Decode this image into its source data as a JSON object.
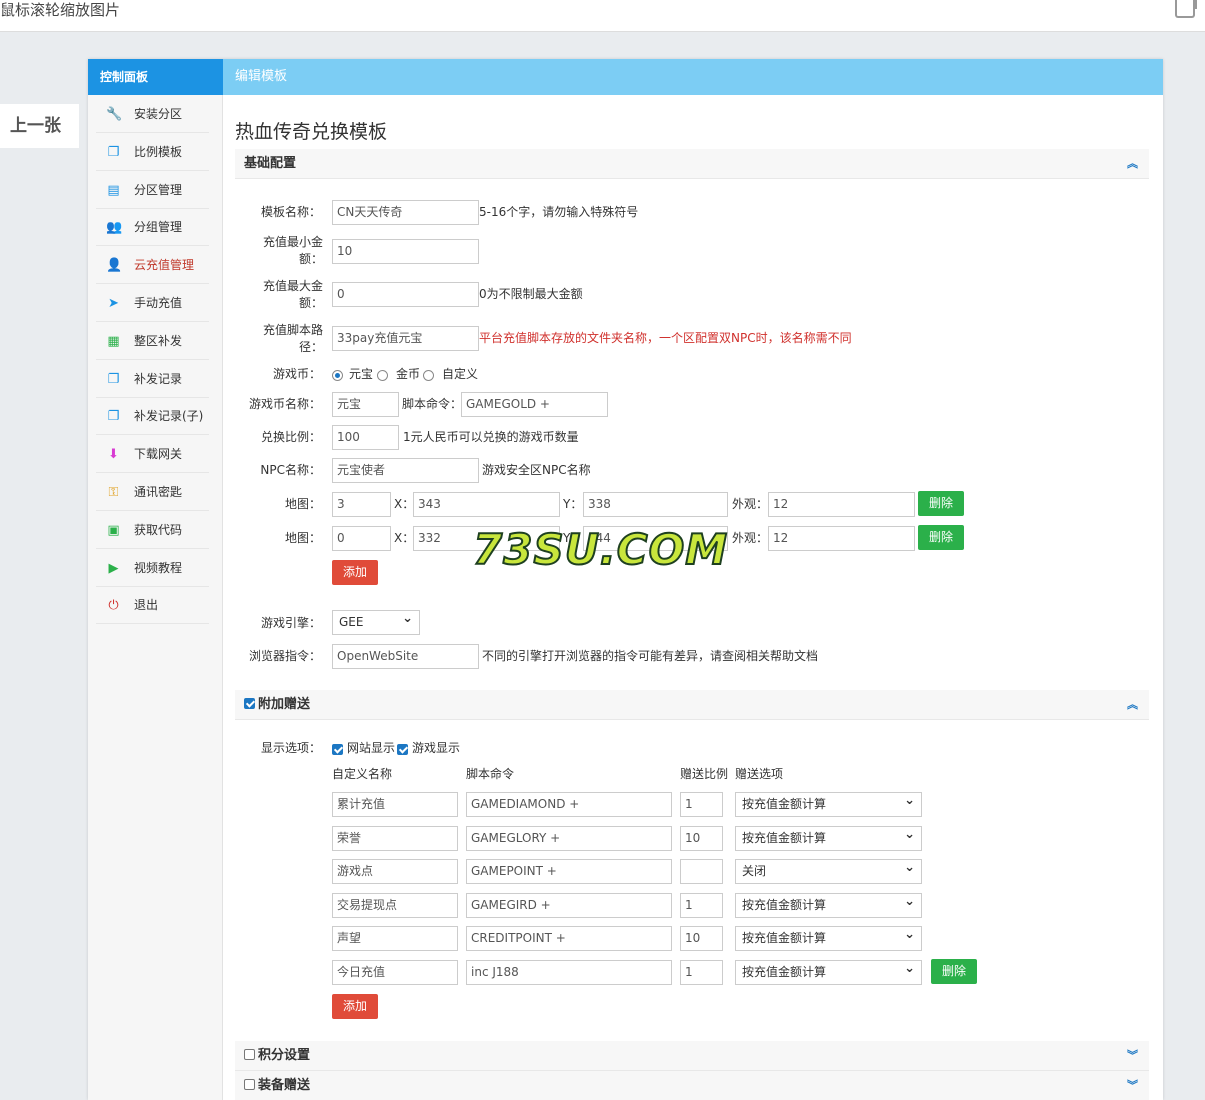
{
  "viewer": {
    "hint": "鼠标滚轮缩放图片",
    "prev": "上一张"
  },
  "header": {
    "panel_title": "控制面板",
    "page_header": "编辑模板"
  },
  "sidebar": {
    "items": [
      {
        "label": "安装分区",
        "icon": "wrench-icon",
        "color": "#e0a020",
        "glyph": "🔧"
      },
      {
        "label": "比例模板",
        "icon": "copy-icon",
        "color": "#1c93e3",
        "glyph": "❐"
      },
      {
        "label": "分区管理",
        "icon": "inbox-icon",
        "color": "#1c93e3",
        "glyph": "▤"
      },
      {
        "label": "分组管理",
        "icon": "users-icon",
        "color": "#2bb04a",
        "glyph": "👥"
      },
      {
        "label": "云充值管理",
        "icon": "user-icon",
        "color": "#1c77c3",
        "glyph": "👤"
      },
      {
        "label": "手动充值",
        "icon": "send-icon",
        "color": "#1c93e3",
        "glyph": "➤"
      },
      {
        "label": "整区补发",
        "icon": "calendar-icon",
        "color": "#2bb04a",
        "glyph": "▦"
      },
      {
        "label": "补发记录",
        "icon": "copy-icon",
        "color": "#1c93e3",
        "glyph": "❐"
      },
      {
        "label": "补发记录(子)",
        "icon": "copy-icon",
        "color": "#1c93e3",
        "glyph": "❐"
      },
      {
        "label": "下载网关",
        "icon": "download-icon",
        "color": "#d83bd2",
        "glyph": "⬇"
      },
      {
        "label": "通讯密匙",
        "icon": "key-icon",
        "color": "#e0a020",
        "glyph": "⚿"
      },
      {
        "label": "获取代码",
        "icon": "briefcase-icon",
        "color": "#2bb04a",
        "glyph": "▣"
      },
      {
        "label": "视频教程",
        "icon": "video-icon",
        "color": "#2bb04a",
        "glyph": "▶"
      },
      {
        "label": "退出",
        "icon": "power-icon",
        "color": "#d0312d",
        "glyph": "⏻"
      }
    ],
    "active_index": 4,
    "active_color": "#c0392b"
  },
  "main": {
    "title": "热血传奇兑换模板",
    "basic_section": "基础配置",
    "fields": {
      "name_label": "模板名称：",
      "name_value": "CN天天传奇",
      "name_hint": "5-16个字，请勿输入特殊符号",
      "min_label": "充值最小金额：",
      "min_value": "10",
      "max_label": "充值最大金额：",
      "max_value": "0",
      "max_hint": "0为不限制最大金额",
      "script_label": "充值脚本路径：",
      "script_value": "33pay充值元宝",
      "script_hint": "平台充值脚本存放的文件夹名称，一个区配置双NPC时，该名称需不同",
      "currency_label": "游戏币：",
      "currency_options": [
        "元宝",
        "金币",
        "自定义"
      ],
      "currency_selected": 0,
      "coin_name_label": "游戏币名称：",
      "coin_name_value": "元宝",
      "cmd_label": "脚本命令：",
      "cmd_value": "GAMEGOLD +",
      "ratio_label": "兑换比例：",
      "ratio_value": "100",
      "ratio_hint": "1元人民币可以兑换的游戏币数量",
      "npc_label": "NPC名称：",
      "npc_value": "元宝使者",
      "npc_hint": "游戏安全区NPC名称",
      "map_label": "地图：",
      "x_label": "X：",
      "y_label": "Y：",
      "look_label": "外观：",
      "maps": [
        {
          "map": "3",
          "x": "343",
          "y": "338",
          "look": "12"
        },
        {
          "map": "0",
          "x": "332",
          "y": "344",
          "look": "12"
        }
      ],
      "delete_label": "删除",
      "add_label": "添加",
      "engine_label": "游戏引擎：",
      "engine_value": "GEE",
      "browser_label": "浏览器指令：",
      "browser_value": "OpenWebSite",
      "browser_hint": "不同的引擎打开浏览器的指令可能有差异，请查阅相关帮助文档"
    },
    "bonus": {
      "section": "附加赠送",
      "display_label": "显示选项：",
      "opt_site": "网站显示",
      "opt_game": "游戏显示",
      "col_name": "自定义名称",
      "col_cmd": "脚本命令",
      "col_ratio": "赠送比例",
      "col_option": "赠送选项",
      "rows": [
        {
          "name": "累计充值",
          "cmd": "GAMEDIAMOND +",
          "ratio": "1",
          "option": "按充值金额计算"
        },
        {
          "name": "荣誉",
          "cmd": "GAMEGLORY +",
          "ratio": "10",
          "option": "按充值金额计算"
        },
        {
          "name": "游戏点",
          "cmd": "GAMEPOINT +",
          "ratio": "",
          "option": "关闭"
        },
        {
          "name": "交易提现点",
          "cmd": "GAMEGIRD +",
          "ratio": "1",
          "option": "按充值金额计算"
        },
        {
          "name": "声望",
          "cmd": "CREDITPOINT +",
          "ratio": "10",
          "option": "按充值金额计算"
        },
        {
          "name": "今日充值",
          "cmd": "inc J188",
          "ratio": "1",
          "option": "按充值金额计算"
        }
      ],
      "delete_label": "删除",
      "add_label": "添加"
    },
    "points_section": "积分设置",
    "equip_section": "装备赠送"
  },
  "watermark": "73SU.COM"
}
